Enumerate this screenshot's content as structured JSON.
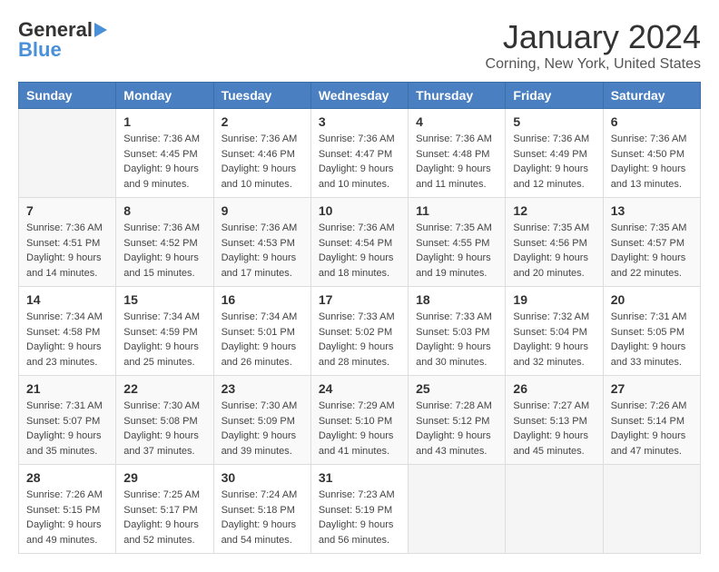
{
  "logo": {
    "general": "General",
    "blue": "Blue"
  },
  "header": {
    "month": "January 2024",
    "location": "Corning, New York, United States"
  },
  "weekdays": [
    "Sunday",
    "Monday",
    "Tuesday",
    "Wednesday",
    "Thursday",
    "Friday",
    "Saturday"
  ],
  "weeks": [
    [
      {
        "day": "",
        "sunrise": "",
        "sunset": "",
        "daylight": ""
      },
      {
        "day": "1",
        "sunrise": "Sunrise: 7:36 AM",
        "sunset": "Sunset: 4:45 PM",
        "daylight": "Daylight: 9 hours and 9 minutes."
      },
      {
        "day": "2",
        "sunrise": "Sunrise: 7:36 AM",
        "sunset": "Sunset: 4:46 PM",
        "daylight": "Daylight: 9 hours and 10 minutes."
      },
      {
        "day": "3",
        "sunrise": "Sunrise: 7:36 AM",
        "sunset": "Sunset: 4:47 PM",
        "daylight": "Daylight: 9 hours and 10 minutes."
      },
      {
        "day": "4",
        "sunrise": "Sunrise: 7:36 AM",
        "sunset": "Sunset: 4:48 PM",
        "daylight": "Daylight: 9 hours and 11 minutes."
      },
      {
        "day": "5",
        "sunrise": "Sunrise: 7:36 AM",
        "sunset": "Sunset: 4:49 PM",
        "daylight": "Daylight: 9 hours and 12 minutes."
      },
      {
        "day": "6",
        "sunrise": "Sunrise: 7:36 AM",
        "sunset": "Sunset: 4:50 PM",
        "daylight": "Daylight: 9 hours and 13 minutes."
      }
    ],
    [
      {
        "day": "7",
        "sunrise": "Sunrise: 7:36 AM",
        "sunset": "Sunset: 4:51 PM",
        "daylight": "Daylight: 9 hours and 14 minutes."
      },
      {
        "day": "8",
        "sunrise": "Sunrise: 7:36 AM",
        "sunset": "Sunset: 4:52 PM",
        "daylight": "Daylight: 9 hours and 15 minutes."
      },
      {
        "day": "9",
        "sunrise": "Sunrise: 7:36 AM",
        "sunset": "Sunset: 4:53 PM",
        "daylight": "Daylight: 9 hours and 17 minutes."
      },
      {
        "day": "10",
        "sunrise": "Sunrise: 7:36 AM",
        "sunset": "Sunset: 4:54 PM",
        "daylight": "Daylight: 9 hours and 18 minutes."
      },
      {
        "day": "11",
        "sunrise": "Sunrise: 7:35 AM",
        "sunset": "Sunset: 4:55 PM",
        "daylight": "Daylight: 9 hours and 19 minutes."
      },
      {
        "day": "12",
        "sunrise": "Sunrise: 7:35 AM",
        "sunset": "Sunset: 4:56 PM",
        "daylight": "Daylight: 9 hours and 20 minutes."
      },
      {
        "day": "13",
        "sunrise": "Sunrise: 7:35 AM",
        "sunset": "Sunset: 4:57 PM",
        "daylight": "Daylight: 9 hours and 22 minutes."
      }
    ],
    [
      {
        "day": "14",
        "sunrise": "Sunrise: 7:34 AM",
        "sunset": "Sunset: 4:58 PM",
        "daylight": "Daylight: 9 hours and 23 minutes."
      },
      {
        "day": "15",
        "sunrise": "Sunrise: 7:34 AM",
        "sunset": "Sunset: 4:59 PM",
        "daylight": "Daylight: 9 hours and 25 minutes."
      },
      {
        "day": "16",
        "sunrise": "Sunrise: 7:34 AM",
        "sunset": "Sunset: 5:01 PM",
        "daylight": "Daylight: 9 hours and 26 minutes."
      },
      {
        "day": "17",
        "sunrise": "Sunrise: 7:33 AM",
        "sunset": "Sunset: 5:02 PM",
        "daylight": "Daylight: 9 hours and 28 minutes."
      },
      {
        "day": "18",
        "sunrise": "Sunrise: 7:33 AM",
        "sunset": "Sunset: 5:03 PM",
        "daylight": "Daylight: 9 hours and 30 minutes."
      },
      {
        "day": "19",
        "sunrise": "Sunrise: 7:32 AM",
        "sunset": "Sunset: 5:04 PM",
        "daylight": "Daylight: 9 hours and 32 minutes."
      },
      {
        "day": "20",
        "sunrise": "Sunrise: 7:31 AM",
        "sunset": "Sunset: 5:05 PM",
        "daylight": "Daylight: 9 hours and 33 minutes."
      }
    ],
    [
      {
        "day": "21",
        "sunrise": "Sunrise: 7:31 AM",
        "sunset": "Sunset: 5:07 PM",
        "daylight": "Daylight: 9 hours and 35 minutes."
      },
      {
        "day": "22",
        "sunrise": "Sunrise: 7:30 AM",
        "sunset": "Sunset: 5:08 PM",
        "daylight": "Daylight: 9 hours and 37 minutes."
      },
      {
        "day": "23",
        "sunrise": "Sunrise: 7:30 AM",
        "sunset": "Sunset: 5:09 PM",
        "daylight": "Daylight: 9 hours and 39 minutes."
      },
      {
        "day": "24",
        "sunrise": "Sunrise: 7:29 AM",
        "sunset": "Sunset: 5:10 PM",
        "daylight": "Daylight: 9 hours and 41 minutes."
      },
      {
        "day": "25",
        "sunrise": "Sunrise: 7:28 AM",
        "sunset": "Sunset: 5:12 PM",
        "daylight": "Daylight: 9 hours and 43 minutes."
      },
      {
        "day": "26",
        "sunrise": "Sunrise: 7:27 AM",
        "sunset": "Sunset: 5:13 PM",
        "daylight": "Daylight: 9 hours and 45 minutes."
      },
      {
        "day": "27",
        "sunrise": "Sunrise: 7:26 AM",
        "sunset": "Sunset: 5:14 PM",
        "daylight": "Daylight: 9 hours and 47 minutes."
      }
    ],
    [
      {
        "day": "28",
        "sunrise": "Sunrise: 7:26 AM",
        "sunset": "Sunset: 5:15 PM",
        "daylight": "Daylight: 9 hours and 49 minutes."
      },
      {
        "day": "29",
        "sunrise": "Sunrise: 7:25 AM",
        "sunset": "Sunset: 5:17 PM",
        "daylight": "Daylight: 9 hours and 52 minutes."
      },
      {
        "day": "30",
        "sunrise": "Sunrise: 7:24 AM",
        "sunset": "Sunset: 5:18 PM",
        "daylight": "Daylight: 9 hours and 54 minutes."
      },
      {
        "day": "31",
        "sunrise": "Sunrise: 7:23 AM",
        "sunset": "Sunset: 5:19 PM",
        "daylight": "Daylight: 9 hours and 56 minutes."
      },
      {
        "day": "",
        "sunrise": "",
        "sunset": "",
        "daylight": ""
      },
      {
        "day": "",
        "sunrise": "",
        "sunset": "",
        "daylight": ""
      },
      {
        "day": "",
        "sunrise": "",
        "sunset": "",
        "daylight": ""
      }
    ]
  ]
}
